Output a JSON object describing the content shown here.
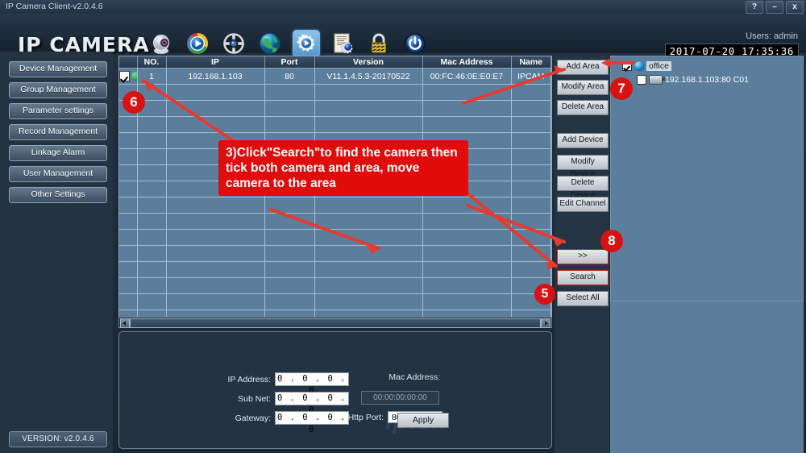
{
  "window": {
    "title": "IP Camera Client-v2.0.4.6",
    "help_label": "?",
    "minimize_label": "–",
    "close_label": "x"
  },
  "header": {
    "logo": "IP CAMERA",
    "users_label": "Users: admin",
    "datetime": "2017-07-20  17:35:36",
    "toolbar_icons": [
      {
        "name": "camera-icon",
        "selected": false
      },
      {
        "name": "playback-icon",
        "selected": false
      },
      {
        "name": "ptz-wheel-icon",
        "selected": false
      },
      {
        "name": "globe-icon",
        "selected": false
      },
      {
        "name": "settings-gear-icon",
        "selected": true
      },
      {
        "name": "log-document-icon",
        "selected": false
      },
      {
        "name": "lock-icon",
        "selected": false
      },
      {
        "name": "power-icon",
        "selected": false
      }
    ]
  },
  "sidebar": {
    "items": [
      {
        "label": "Device Management"
      },
      {
        "label": "Group Management"
      },
      {
        "label": "Parameter settings"
      },
      {
        "label": "Record Management"
      },
      {
        "label": "Linkage Alarm"
      },
      {
        "label": "User Management"
      },
      {
        "label": "Other Settings"
      }
    ],
    "version_label": "VERSION: v2.0.4.6"
  },
  "table": {
    "columns": [
      "",
      "NO.",
      "IP",
      "Port",
      "Version",
      "Mac Address",
      "Name"
    ],
    "rows": [
      {
        "checked": true,
        "no": "1",
        "ip": "192.168.1.103",
        "port": "80",
        "version": "V11.1.4.5.3-20170522",
        "mac": "00:FC:46:0E:E0:E7",
        "name": "IPCAM"
      }
    ],
    "empty_row_count": 15
  },
  "actions": {
    "area_buttons": [
      {
        "label": "Add Area",
        "highlight": false
      },
      {
        "label": "Modify Area",
        "highlight": false
      },
      {
        "label": "Delete Area",
        "highlight": false
      }
    ],
    "device_buttons": [
      {
        "label": "Add Device",
        "highlight": false
      },
      {
        "label": "Modify Device",
        "highlight": false
      },
      {
        "label": "Delete Device",
        "highlight": false
      },
      {
        "label": "Edit Channel",
        "highlight": false
      }
    ],
    "search_buttons": [
      {
        "label": ">>",
        "highlight": true
      },
      {
        "label": "Search",
        "highlight": true
      },
      {
        "label": "Select All",
        "highlight": false
      }
    ]
  },
  "tree": {
    "nodes": [
      {
        "label": "office",
        "checked": true,
        "icon": "globe-icon",
        "selected": true,
        "level": 0
      },
      {
        "label": "192.168.1.103:80 C01",
        "checked": false,
        "icon": "camera-icon",
        "selected": false,
        "level": 1
      }
    ]
  },
  "form": {
    "ip_address_label": "IP Address:",
    "ip_address_value": "0 . 0 . 0 . 0",
    "sub_net_label": "Sub Net:",
    "sub_net_value": "0 . 0 . 0 . 0",
    "gateway_label": "Gateway:",
    "gateway_value": "0 . 0 . 0 . 0",
    "mac_address_label": "Mac Address:",
    "mac_address_value": "00:00:00:00:00",
    "http_port_label": "Http Port:",
    "http_port_value": "80",
    "apply_label": "Apply",
    "watermark": "iptek"
  },
  "annotations": {
    "callout": "3)Click\"Search\"to find the camera then tick both camera and area, move camera to the area",
    "markers": [
      {
        "id": "5",
        "label": "5"
      },
      {
        "id": "6",
        "label": "6"
      },
      {
        "id": "7",
        "label": "7"
      },
      {
        "id": "8",
        "label": "8"
      }
    ],
    "color": "#d81212"
  }
}
